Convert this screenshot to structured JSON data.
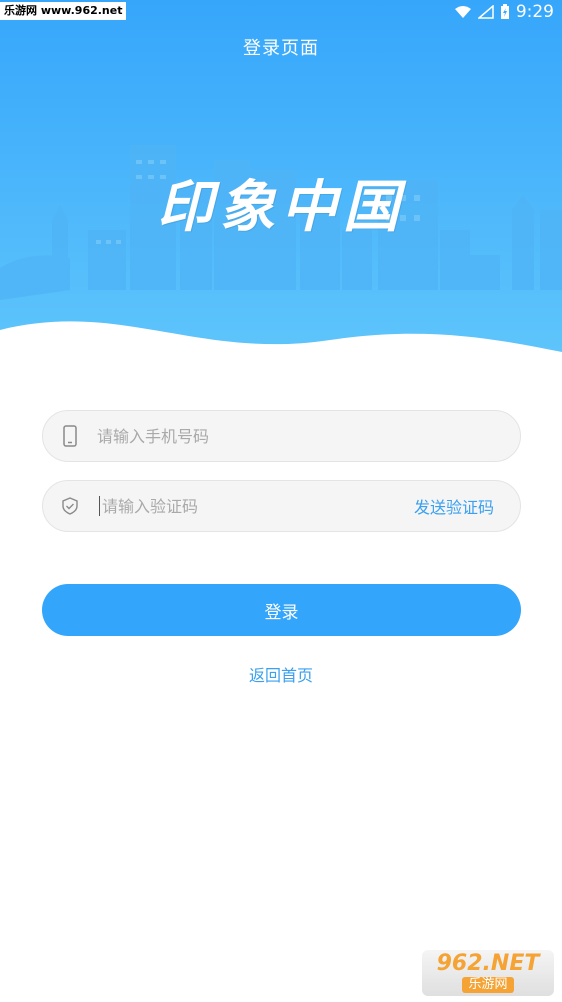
{
  "statusbar": {
    "watermark": "乐游网 www.962.net",
    "time": "9:29"
  },
  "header": {
    "title": "登录页面",
    "brand": "印象中国"
  },
  "form": {
    "phone_placeholder": "请输入手机号码",
    "code_placeholder": "请输入验证码",
    "send_code_label": "发送验证码",
    "login_label": "登录",
    "back_home_label": "返回首页"
  },
  "watermark_bottom": {
    "brand": "962.NET",
    "sub": "乐游网"
  },
  "colors": {
    "primary": "#33a5fb",
    "link": "#3aa0ef",
    "header_top": "#37a8fb",
    "header_bottom": "#5cc3fb"
  }
}
